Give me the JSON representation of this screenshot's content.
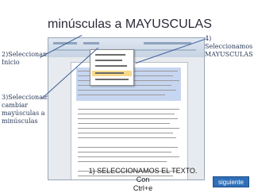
{
  "slide": {
    "title": "minúsculas a MAYUSCULAS",
    "notes": {
      "step2": "2)Seleccionamos Inicio",
      "step3": "3)Seleccionamos cambiar mayúsculas a minúsculas",
      "step4": "4) Seleccionamos MAYUSCULAS"
    },
    "caption_line1": "1) SELECCIONAMOS  EL TEXTO. Con",
    "caption_line2": "Ctrl+e",
    "next_button": "siguiente"
  },
  "colors": {
    "title": "#2a2a3a",
    "notes": "#2a3a5a",
    "button_bg": "#2f6fb8",
    "button_text": "#ffffff",
    "selection": "#c7d6f0",
    "menu_highlight": "#f7d98a"
  }
}
